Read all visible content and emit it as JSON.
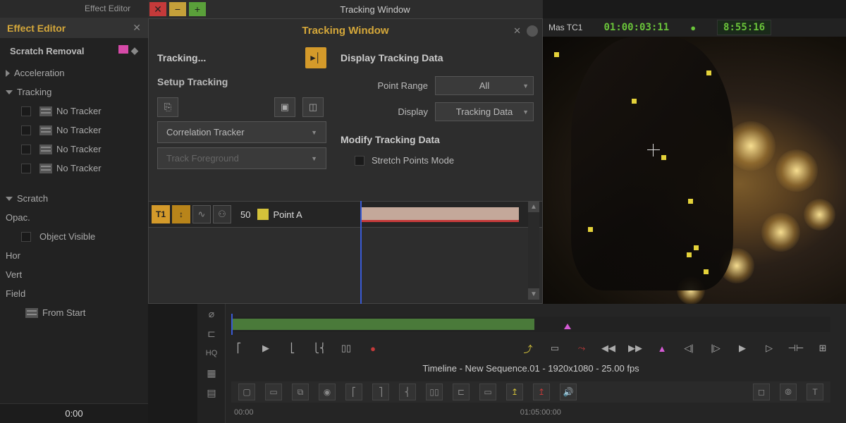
{
  "sidebar": {
    "header_tab": "Effect Editor",
    "title": "Effect Editor",
    "effect_name": "Scratch Removal",
    "params": [
      {
        "label": "Acceleration",
        "expanded": false
      },
      {
        "label": "Tracking",
        "expanded": true
      }
    ],
    "trackers": [
      "No Tracker",
      "No Tracker",
      "No Tracker",
      "No Tracker"
    ],
    "scratch_section": "Scratch",
    "opac_label": "Opac.",
    "object_visible": "Object Visible",
    "hor": "Hor",
    "vert": "Vert",
    "field": "Field",
    "from_start": "From Start",
    "footer_time": "0:00"
  },
  "window": {
    "title": "Tracking Window"
  },
  "tracking": {
    "title": "Tracking Window",
    "status": "Tracking...",
    "setup_label": "Setup Tracking",
    "tracker_type": "Correlation Tracker",
    "track_target": "Track Foreground",
    "display_section": "Display Tracking Data",
    "point_range_label": "Point Range",
    "point_range_value": "All",
    "display_label": "Display",
    "display_value": "Tracking Data",
    "modify_section": "Modify Tracking Data",
    "stretch_mode": "Stretch Points Mode",
    "lane": {
      "t1": "T1",
      "num": "50",
      "point": "Point A"
    }
  },
  "viewer": {
    "tc_label": "Mas TC1",
    "tc1": "01:00:03:11",
    "tc2": "8:55:16"
  },
  "timeline": {
    "hq": "HQ",
    "title": "Timeline - New Sequence.01 - 1920x1080 - 25.00 fps",
    "tcs": [
      "00:00",
      "01:05:00:00"
    ]
  }
}
